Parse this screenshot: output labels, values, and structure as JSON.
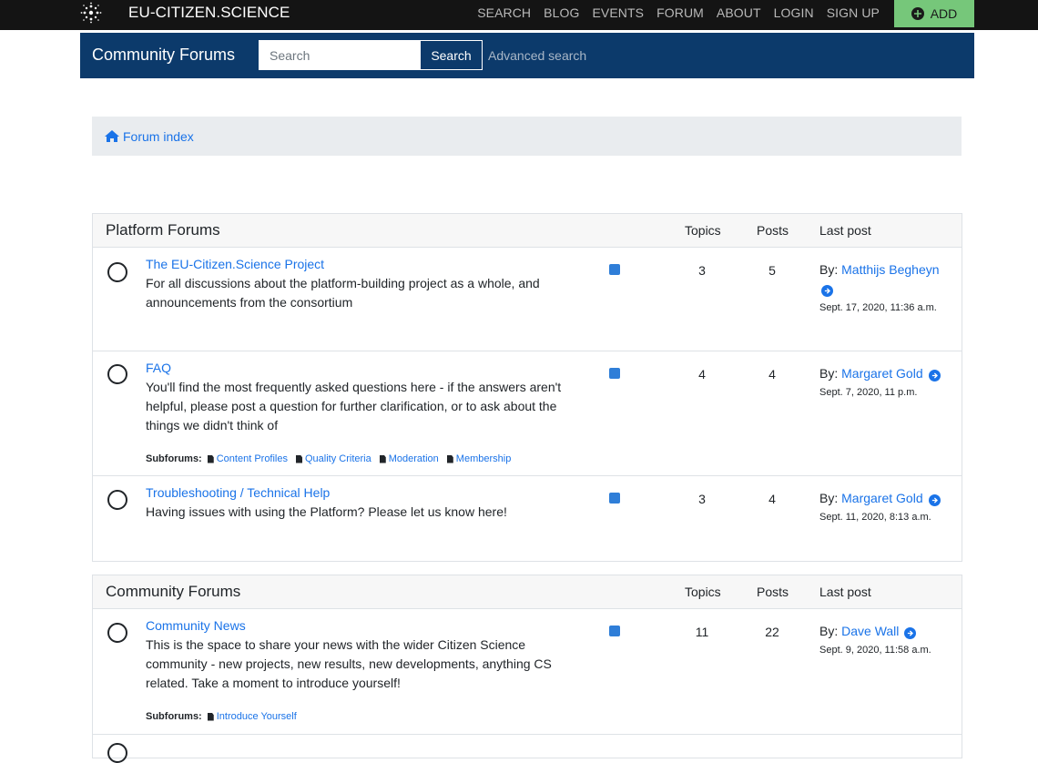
{
  "brand": {
    "name": "EU-CITIZEN.SCIENCE",
    "logo_icon": "sunburst-logo-icon"
  },
  "topnav": {
    "items": [
      "SEARCH",
      "BLOG",
      "EVENTS",
      "FORUM",
      "ABOUT",
      "LOGIN",
      "SIGN UP"
    ],
    "add_label": "ADD"
  },
  "forumbar": {
    "title": "Community Forums",
    "search_placeholder": "Search",
    "search_button": "Search",
    "advanced_search": "Advanced search"
  },
  "breadcrumb": {
    "label": "Forum index",
    "icon": "home-icon"
  },
  "columns": {
    "topics": "Topics",
    "posts": "Posts",
    "last_post": "Last post"
  },
  "sections": [
    {
      "title": "Platform Forums",
      "forums": [
        {
          "name": "The EU-Citizen.Science Project",
          "description": "For all discussions about the platform-building project as a whole, and announcements from the consortium",
          "topics": "3",
          "posts": "5",
          "last_by": "By:",
          "last_author": "Matthijs Begheyn",
          "last_date": "Sept. 17, 2020, 11:36 a.m."
        },
        {
          "name": "FAQ",
          "description": "You'll find the most frequently asked questions here - if the answers aren't helpful, please post a question for further clarification, or to ask about the things we didn't think of",
          "topics": "4",
          "posts": "4",
          "last_by": "By:",
          "last_author": "Margaret Gold",
          "last_date": "Sept. 7, 2020, 11 p.m.",
          "subforums_label": "Subforums:",
          "subforums": [
            "Content Profiles",
            "Quality Criteria",
            "Moderation",
            "Membership"
          ]
        },
        {
          "name": "Troubleshooting / Technical Help",
          "description": "Having issues with using the Platform? Please let us know here!",
          "topics": "3",
          "posts": "4",
          "last_by": "By:",
          "last_author": "Margaret Gold",
          "last_date": "Sept. 11, 2020, 8:13 a.m."
        }
      ]
    },
    {
      "title": "Community Forums",
      "forums": [
        {
          "name": "Community News",
          "description": "This is the space to share your news with the wider Citizen Science community - new projects, new results, new developments, anything CS related. Take a moment to introduce yourself!",
          "topics": "11",
          "posts": "22",
          "last_by": "By:",
          "last_author": "Dave Wall",
          "last_date": "Sept. 9, 2020, 11:58 a.m.",
          "subforums_label": "Subforums:",
          "subforums": [
            "Introduce Yourself"
          ]
        }
      ]
    }
  ],
  "colors": {
    "navbar": "#141414",
    "forumbar": "#0c3a6b",
    "add_button": "#76c77a",
    "link": "#1a73e8"
  }
}
